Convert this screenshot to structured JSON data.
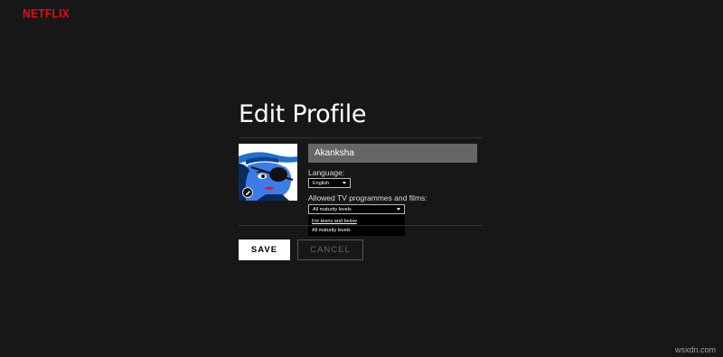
{
  "header": {
    "logo": "NETFLIX"
  },
  "page": {
    "title": "Edit Profile"
  },
  "profile": {
    "name_value": "Akanksha",
    "avatar": "pirate-avatar",
    "edit_icon": "pencil-icon"
  },
  "language": {
    "label": "Language:",
    "selected": "English"
  },
  "maturity": {
    "label": "Allowed TV programmes and films:",
    "selected": "All maturity levels",
    "options": [
      "For teens and below",
      "All maturity levels"
    ]
  },
  "actions": {
    "save_label": "SAVE",
    "cancel_label": "CANCEL"
  },
  "watermark": "wsxdn.com",
  "colors": {
    "brand": "#e50914",
    "background": "#161616",
    "input_bg": "#666666"
  }
}
